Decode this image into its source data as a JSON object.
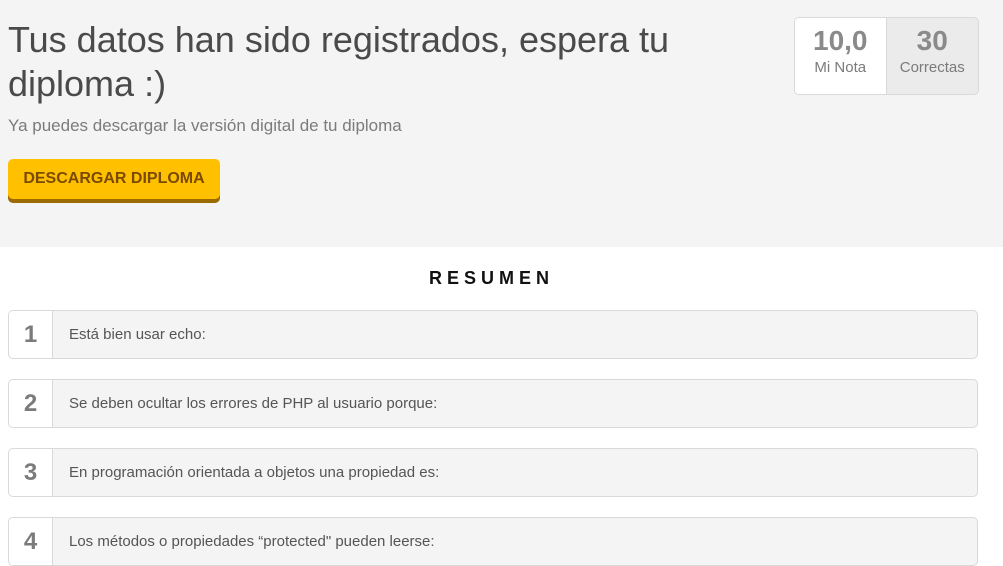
{
  "header": {
    "title": "Tus datos han sido registrados, espera tu diploma :)",
    "subtitle": "Ya puedes descargar la versión digital de tu diploma",
    "download_label": "DESCARGAR DIPLOMA"
  },
  "score": {
    "grade_value": "10,0",
    "grade_label": "Mi Nota",
    "correct_value": "30",
    "correct_label": "Correctas"
  },
  "summary": {
    "title": "RESUMEN",
    "questions": [
      {
        "number": "1",
        "text": "Está bien usar echo:"
      },
      {
        "number": "2",
        "text": "Se deben ocultar los errores de PHP al usuario porque:"
      },
      {
        "number": "3",
        "text": "En programación orientada a objetos una propiedad es:"
      },
      {
        "number": "4",
        "text": "Los métodos o propiedades “protected\" pueden leerse:"
      }
    ]
  },
  "colors": {
    "button": "#ffc000",
    "button_shadow": "#9b6a00",
    "top_background": "#f4f4f4"
  }
}
